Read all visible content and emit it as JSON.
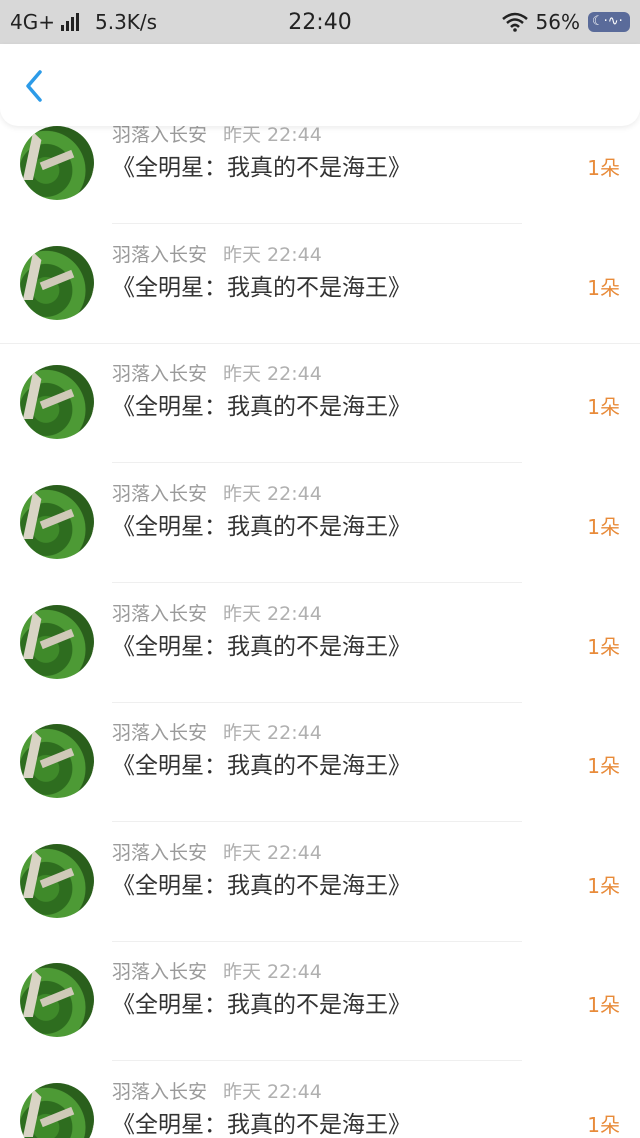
{
  "status_bar": {
    "network": "4G+",
    "speed": "5.3K/s",
    "time": "22:40",
    "battery": "56%",
    "icons": [
      "signal-icon",
      "wifi-icon",
      "battery-icon"
    ]
  },
  "nav": {
    "back_icon": "chevron-left-icon",
    "accent": "#2c9be8"
  },
  "colors": {
    "amount": "#e88b3a",
    "meta": "#9a9a9a",
    "title": "#333333"
  },
  "items": [
    {
      "name": "羽落入长安",
      "time": "昨天 22:44",
      "title": "《全明星：我真的不是海王》",
      "amount": "1朵"
    },
    {
      "name": "羽落入长安",
      "time": "昨天 22:44",
      "title": "《全明星：我真的不是海王》",
      "amount": "1朵"
    },
    {
      "name": "羽落入长安",
      "time": "昨天 22:44",
      "title": "《全明星：我真的不是海王》",
      "amount": "1朵"
    },
    {
      "name": "羽落入长安",
      "time": "昨天 22:44",
      "title": "《全明星：我真的不是海王》",
      "amount": "1朵"
    },
    {
      "name": "羽落入长安",
      "time": "昨天 22:44",
      "title": "《全明星：我真的不是海王》",
      "amount": "1朵"
    },
    {
      "name": "羽落入长安",
      "time": "昨天 22:44",
      "title": "《全明星：我真的不是海王》",
      "amount": "1朵"
    },
    {
      "name": "羽落入长安",
      "time": "昨天 22:44",
      "title": "《全明星：我真的不是海王》",
      "amount": "1朵"
    },
    {
      "name": "羽落入长安",
      "time": "昨天 22:44",
      "title": "《全明星：我真的不是海王》",
      "amount": "1朵"
    },
    {
      "name": "羽落入长安",
      "time": "昨天 22:44",
      "title": "《全明星：我真的不是海王》",
      "amount": "1朵"
    }
  ]
}
